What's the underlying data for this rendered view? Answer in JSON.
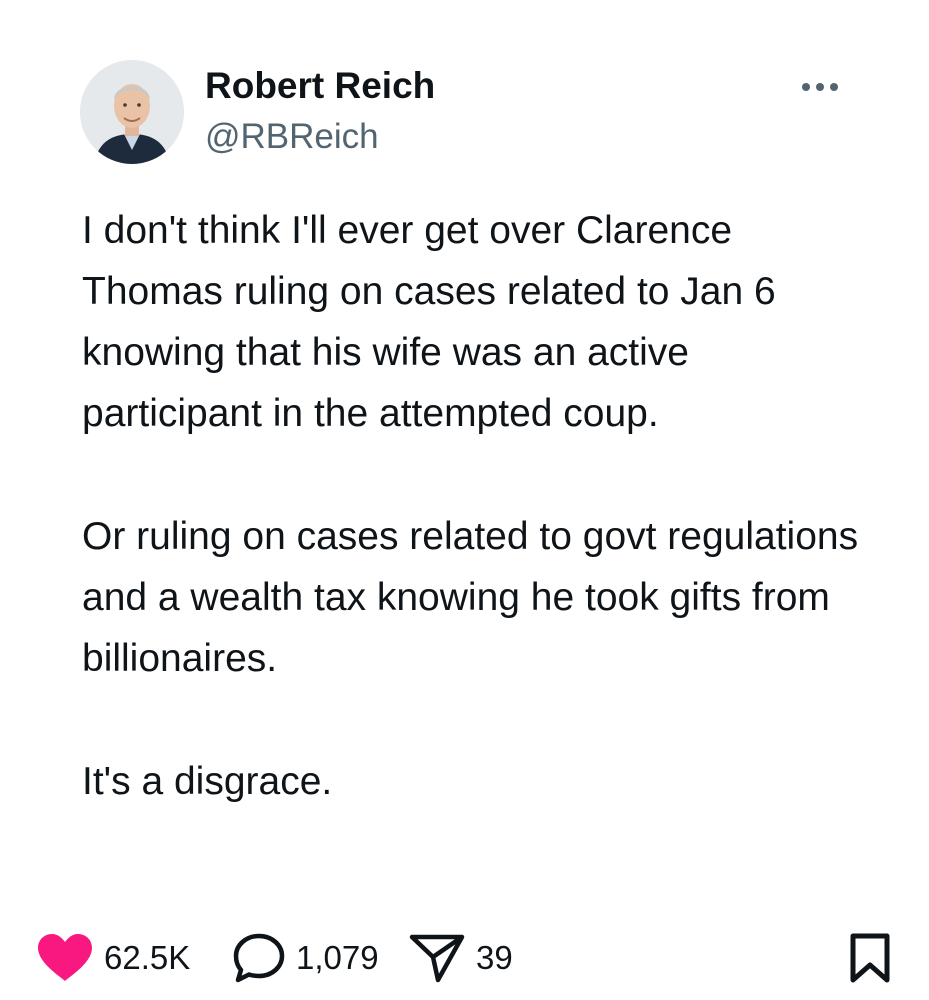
{
  "author": {
    "display_name": "Robert Reich",
    "handle": "@RBReich",
    "avatar_icon": "profile-photo"
  },
  "menu": {
    "icon": "more-horizontal-icon"
  },
  "tweet": {
    "paragraphs": [
      "I don't think I'll ever get over Clarence Thomas ruling on cases related to Jan 6 knowing that his wife was an active participant in the attempted coup.",
      "Or ruling on cases related to govt regulations and a wealth tax knowing he took gifts from billionaires.",
      "It's a disgrace."
    ]
  },
  "actions": {
    "likes": {
      "count": "62.5K",
      "icon": "heart-icon",
      "color": "#f91880"
    },
    "replies": {
      "count": "1,079",
      "icon": "speech-bubble-icon"
    },
    "shares": {
      "count": "39",
      "icon": "paper-plane-icon"
    },
    "bookmark": {
      "icon": "bookmark-icon"
    }
  }
}
